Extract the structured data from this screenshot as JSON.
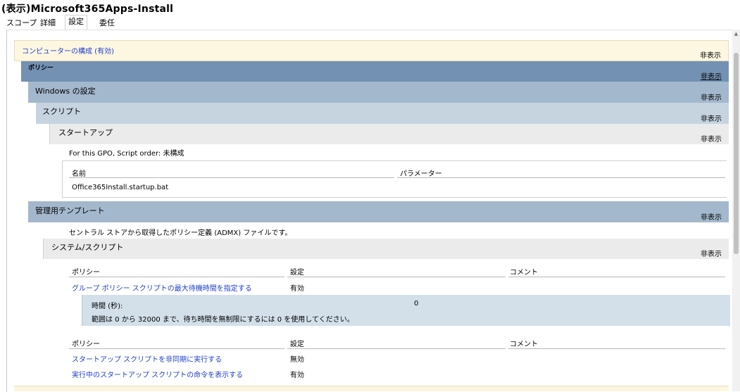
{
  "window": {
    "title": "(表示)Microsoft365Apps-Install"
  },
  "tabs": [
    {
      "label": "スコープ"
    },
    {
      "label": "詳細"
    },
    {
      "label": "設定"
    },
    {
      "label": "委任"
    }
  ],
  "hide_label": "非表示",
  "sections": {
    "computer_config": "コンピューターの構成 (有効)",
    "policies": "ポリシー",
    "windows_settings": "Windows の設定",
    "scripts": "スクリプト",
    "startup": "スタートアップ",
    "script_order": "For this GPO, Script order: 未構成",
    "admin_templates": "管理用テンプレート",
    "admx_note": "セントラル ストアから取得したポリシー定義 (ADMX) ファイルです。",
    "system_scripts": "システム/スクリプト"
  },
  "startup_table": {
    "headers": {
      "name": "名前",
      "params": "パラメーター"
    },
    "rows": [
      {
        "name": "Office365Install.startup.bat",
        "params": ""
      }
    ]
  },
  "policy_table_1": {
    "headers": {
      "policy": "ポリシー",
      "setting": "設定",
      "comment": "コメント"
    },
    "rows": [
      {
        "policy": "グループ ポリシー スクリプトの最大待機時間を指定する",
        "setting": "有効",
        "comment": ""
      }
    ],
    "detail": {
      "label": "時間 (秒):",
      "value": "0",
      "note": "範囲は 0 から 32000 まで、待ち時間を無制限にするには 0 を使用してください。"
    }
  },
  "policy_table_2": {
    "headers": {
      "policy": "ポリシー",
      "setting": "設定",
      "comment": "コメント"
    },
    "rows": [
      {
        "policy": "スタートアップ スクリプトを非同期に実行する",
        "setting": "無効",
        "comment": ""
      },
      {
        "policy": "実行中のスタートアップ スクリプトの命令を表示する",
        "setting": "有効",
        "comment": ""
      }
    ]
  },
  "colors": {
    "computer_config_band": "#fdf6e0",
    "policies_band": "#7391b3",
    "windows_settings_band": "#a3b8cc",
    "scripts_band": "#c6d4e0",
    "startup_band": "#ebebeb",
    "detail_box": "#d3e0ea",
    "link": "#1f3fcc"
  }
}
